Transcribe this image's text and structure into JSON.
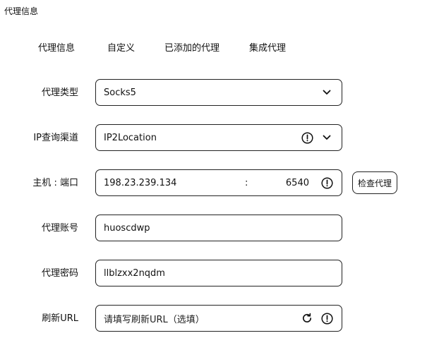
{
  "page": {
    "title": "代理信息"
  },
  "tabs": [
    {
      "label": "代理信息"
    },
    {
      "label": "自定义"
    },
    {
      "label": "已添加的代理"
    },
    {
      "label": "集成代理"
    }
  ],
  "form": {
    "proxy_type": {
      "label": "代理类型",
      "value": "Socks5",
      "icons": [
        "chevron-down-icon"
      ]
    },
    "ip_channel": {
      "label": "IP查询渠道",
      "value": "IP2Location",
      "icons": [
        "info-circle-icon",
        "chevron-down-icon"
      ]
    },
    "host_port": {
      "label": "主机 : 端口",
      "host": "198.23.239.134",
      "separator": ":",
      "port": "6540",
      "icons": [
        "info-circle-icon"
      ],
      "check_button_label": "检查代理"
    },
    "account": {
      "label": "代理账号",
      "value": "huoscdwp"
    },
    "password": {
      "label": "代理密码",
      "value": "llblzxx2nqdm"
    },
    "refresh_url": {
      "label": "刷新URL",
      "placeholder": "请填写刷新URL（选填）",
      "value": "",
      "icons": [
        "refresh-icon",
        "info-circle-icon"
      ]
    }
  }
}
